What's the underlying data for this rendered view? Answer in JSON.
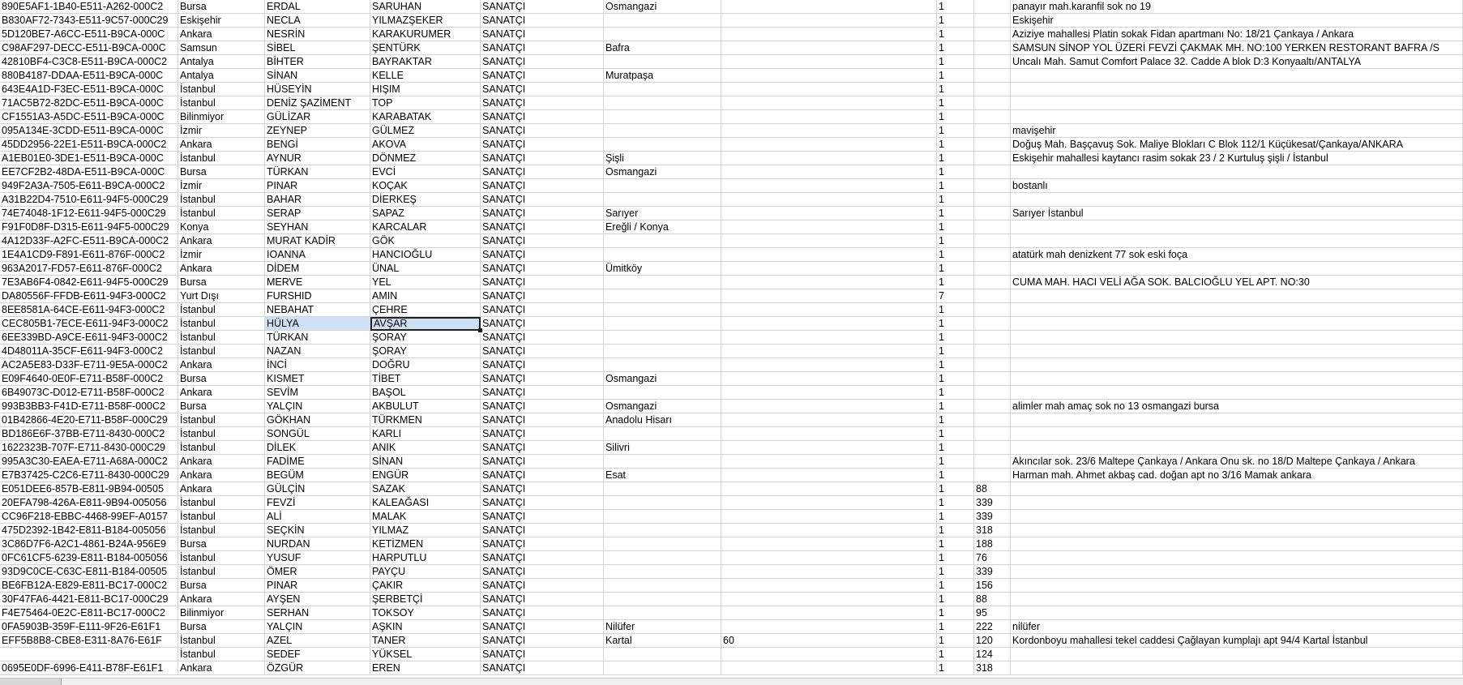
{
  "sheet": {
    "rows": [
      [
        "890E5AF1-1B40-E511-A262-000C2",
        "Bursa",
        "ERDAL",
        "SARUHAN",
        "SANATÇI",
        "Osmangazi",
        "",
        "1",
        "",
        "panayır mah.karanfil sok no 19"
      ],
      [
        "B830AF72-7343-E511-9C57-000C29",
        "Eskişehir",
        "NECLA",
        "YILMAZŞEKER",
        "SANATÇI",
        "",
        "",
        "1",
        "",
        "Eskişehir"
      ],
      [
        "5D120BE7-A6CC-E511-B9CA-000C",
        "Ankara",
        "NESRİN",
        "KARAKURUMER",
        "SANATÇI",
        "",
        "",
        "1",
        "",
        "Aziziye mahallesi Platin sokak  Fidan apartmanı No: 18/21 Çankaya / Ankara"
      ],
      [
        "C98AF297-DECC-E511-B9CA-000C",
        "Samsun",
        "SİBEL",
        "ŞENTÜRK",
        "SANATÇI",
        "Bafra",
        "",
        "1",
        "",
        "SAMSUN SİNOP YOL ÜZERİ FEVZİ ÇAKMAK MH.  NO:100 YERKEN RESTORANT  BAFRA /S"
      ],
      [
        "42810BF4-C3C8-E511-B9CA-000C2",
        "Antalya",
        "BİHTER",
        "BAYRAKTAR",
        "SANATÇI",
        "",
        "",
        "1",
        "",
        "Uncalı Mah. Samut Comfort Palace 32. Cadde A blok D:3 Konyaaltı/ANTALYA"
      ],
      [
        "880B4187-DDAA-E511-B9CA-000C",
        "Antalya",
        "SİNAN",
        "KELLE",
        "SANATÇI",
        "Muratpaşa",
        "",
        "1",
        "",
        ""
      ],
      [
        "643E4A1D-F3EC-E511-B9CA-000C",
        "İstanbul",
        "HÜSEYİN",
        "HIŞIM",
        "SANATÇI",
        "",
        "",
        "1",
        "",
        ""
      ],
      [
        "71AC5B72-82DC-E511-B9CA-000C",
        "İstanbul",
        "DENİZ ŞAZİMENT",
        "TOP",
        "SANATÇI",
        "",
        "",
        "1",
        "",
        ""
      ],
      [
        "CF1551A3-A5DC-E511-B9CA-000C",
        "Bilinmiyor",
        "GÜLİZAR",
        "KARABATAK",
        "SANATÇI",
        "",
        "",
        "1",
        "",
        ""
      ],
      [
        "095A134E-3CDD-E511-B9CA-000C",
        "İzmir",
        "ZEYNEP",
        "GÜLMEZ",
        "SANATÇI",
        "",
        "",
        "1",
        "",
        "mavişehir"
      ],
      [
        "45DD2956-22E1-E511-B9CA-000C2",
        "Ankara",
        "BENGİ",
        "AKOVA",
        "SANATÇI",
        "",
        "",
        "1",
        "",
        "Doğuş Mah. Başçavuş Sok. Maliye Blokları C Blok 112/1 Küçükesat/Çankaya/ANKARA"
      ],
      [
        "A1EB01E0-3DE1-E511-B9CA-000C",
        "İstanbul",
        "AYNUR",
        "DÖNMEZ",
        "SANATÇI",
        "Şişli",
        "",
        "1",
        "",
        "Eskişehir mahallesi kaytancı rasim sokak 23 / 2 Kurtuluş şişli / İstanbul"
      ],
      [
        "EE7CF2B2-48DA-E511-B9CA-000C",
        "Bursa",
        "TÜRKAN",
        "EVCİ",
        "SANATÇI",
        "Osmangazi",
        "",
        "1",
        "",
        ""
      ],
      [
        "949F2A3A-7505-E611-B9CA-000C2",
        "İzmir",
        "PINAR",
        "KOÇAK",
        "SANATÇI",
        "",
        "",
        "1",
        "",
        "bostanlı"
      ],
      [
        "A31B22D4-7510-E611-94F5-000C29",
        "İstanbul",
        "BAHAR",
        "DİERKEŞ",
        "SANATÇI",
        "",
        "",
        "1",
        "",
        ""
      ],
      [
        "74E74048-1F12-E611-94F5-000C29",
        "İstanbul",
        "SERAP",
        "SAPAZ",
        "SANATÇI",
        "Sarıyer",
        "",
        "1",
        "",
        "Sarıyer İstanbul"
      ],
      [
        "F91F0D8F-D315-E611-94F5-000C29",
        "Konya",
        "SEYHAN",
        "KARCALAR",
        "SANATÇI",
        "Ereğli / Konya",
        "",
        "1",
        "",
        ""
      ],
      [
        "4A12D33F-A2FC-E511-B9CA-000C2",
        "Ankara",
        "MURAT KADİR",
        "GÖK",
        "SANATÇI",
        "",
        "",
        "1",
        "",
        ""
      ],
      [
        "1E4A1CD9-F891-E611-876F-000C2",
        "İzmir",
        "IOANNA",
        "HANCIOĞLU",
        "SANATÇI",
        "",
        "",
        "1",
        "",
        "atatürk mah denizkent 77 sok eski foça"
      ],
      [
        "963A2017-FD57-E611-876F-000C2",
        "Ankara",
        "DİDEM",
        "ÜNAL",
        "SANATÇI",
        "Ümitköy",
        "",
        "1",
        "",
        ""
      ],
      [
        "7E3AB6F4-0842-E611-94F5-000C29",
        "Bursa",
        "MERVE",
        "YEL",
        "SANATÇI",
        "",
        "",
        "1",
        "",
        "CUMA MAH. HACI VELİ AĞA SOK. BALCIOĞLU YEL APT. NO:30"
      ],
      [
        "DA80556F-FFDB-E611-94F3-000C2",
        "Yurt Dışı",
        "FURSHID",
        "AMIN",
        "SANATÇI",
        "",
        "",
        "7",
        "",
        ""
      ],
      [
        "8EE8581A-64CE-E611-94F3-000C2",
        "İstanbul",
        "NEBAHAT",
        "ÇEHRE",
        "SANATÇI",
        "",
        "",
        "1",
        "",
        ""
      ],
      [
        "CEC805B1-7ECE-E611-94F3-000C2",
        "İstanbul",
        "HÜLYA",
        "AVŞAR",
        "SANATÇI",
        "",
        "",
        "1",
        "",
        ""
      ],
      [
        "6EE339BD-A9CE-E611-94F3-000C2",
        "İstanbul",
        "TÜRKAN",
        "ŞORAY",
        "SANATÇI",
        "",
        "",
        "1",
        "",
        ""
      ],
      [
        "4D48011A-35CF-E611-94F3-000C2",
        "İstanbul",
        "NAZAN",
        "ŞORAY",
        "SANATÇI",
        "",
        "",
        "1",
        "",
        ""
      ],
      [
        "AC2A5E83-D33F-E711-9E5A-000C2",
        "Ankara",
        "İNCİ",
        "DOĞRU",
        "SANATÇI",
        "",
        "",
        "1",
        "",
        ""
      ],
      [
        "E09F4640-0E0F-E711-B58F-000C2",
        "Bursa",
        "KISMET",
        "TİBET",
        "SANATÇI",
        "Osmangazi",
        "",
        "1",
        "",
        ""
      ],
      [
        "6B49073C-D012-E711-B58F-000C2",
        "Ankara",
        "SEVİM",
        "BAŞOL",
        "SANATÇI",
        "",
        "",
        "1",
        "",
        ""
      ],
      [
        "993B3BB3-F41D-E711-B58F-000C2",
        "Bursa",
        "YALÇIN",
        "AKBULUT",
        "SANATÇI",
        "Osmangazi",
        "",
        "1",
        "",
        "alimler mah amaç sok no 13 osmangazi bursa"
      ],
      [
        "01B42866-4E20-E711-B58F-000C29",
        "İstanbul",
        "GÖKHAN",
        "TÜRKMEN",
        "SANATÇI",
        "Anadolu Hisarı",
        "",
        "1",
        "",
        ""
      ],
      [
        "BD186E6F-37BB-E711-8430-000C2",
        "İstanbul",
        "SONGÜL",
        "KARLI",
        "SANATÇI",
        "",
        "",
        "1",
        "",
        ""
      ],
      [
        "1622323B-707F-E711-8430-000C29",
        "İstanbul",
        "DİLEK",
        "ANIK",
        "SANATÇI",
        "Silivri",
        "",
        "1",
        "",
        ""
      ],
      [
        "995A3C30-EAEA-E711-A68A-000C2",
        "Ankara",
        "FADİME",
        "SİNAN",
        "SANATÇI",
        "",
        "",
        "1",
        "",
        "Akıncılar sok. 23/6 Maltepe Çankaya / Ankara Onu sk. no 18/D  Maltepe  Çankaya  / Ankara"
      ],
      [
        "E7B37425-C2C6-E711-8430-000C29",
        "Ankara",
        "BEGÜM",
        "ENGÜR",
        "SANATÇI",
        "Esat",
        "",
        "1",
        "",
        "Harman mah. Ahmet akbaş cad. doğan apt no 3/16 Mamak ankara"
      ],
      [
        "E051DEE6-857B-E811-9B94-00505",
        "Ankara",
        "GÜLÇİN",
        "SAZAK",
        "SANATÇI",
        "",
        "",
        "1",
        "88",
        ""
      ],
      [
        "20EFA798-426A-E811-9B94-005056",
        "İstanbul",
        "FEVZİ",
        "KALEAĞASI",
        "SANATÇI",
        "",
        "",
        "1",
        "339",
        ""
      ],
      [
        "CC96F218-EBBC-4468-99EF-A0157",
        "İstanbul",
        "ALİ",
        "MALAK",
        "SANATÇI",
        "",
        "",
        "1",
        "339",
        ""
      ],
      [
        "475D2392-1B42-E811-B184-005056",
        "İstanbul",
        "SEÇKİN",
        "YILMAZ",
        "SANATÇI",
        "",
        "",
        "1",
        "318",
        ""
      ],
      [
        "3C86D7F6-A2C1-4861-B24A-956E9",
        "Bursa",
        "NURDAN",
        "KETİZMEN",
        "SANATÇI",
        "",
        "",
        "1",
        "188",
        ""
      ],
      [
        "0FC61CF5-6239-E811-B184-005056",
        "İstanbul",
        "YUSUF",
        "HARPUTLU",
        "SANATÇI",
        "",
        "",
        "1",
        "76",
        ""
      ],
      [
        "93D9C0CE-C63C-E811-B184-00505",
        "İstanbul",
        "ÖMER",
        "PAYÇU",
        "SANATÇI",
        "",
        "",
        "1",
        "339",
        ""
      ],
      [
        "BE6FB12A-E829-E811-BC17-000C2",
        "Bursa",
        "PINAR",
        "ÇAKIR",
        "SANATÇI",
        "",
        "",
        "1",
        "156",
        ""
      ],
      [
        "30F47FA6-4421-E811-BC17-000C29",
        "Ankara",
        "AYŞEN",
        "ŞERBETÇİ",
        "SANATÇI",
        "",
        "",
        "1",
        "88",
        ""
      ],
      [
        "F4E75464-0E2C-E811-BC17-000C2",
        "Bilinmiyor",
        "SERHAN",
        "TOKSOY",
        "SANATÇI",
        "",
        "",
        "1",
        "95",
        ""
      ],
      [
        "0FA5903B-359F-E111-9F26-E61F1",
        "Bursa",
        "YALÇIN",
        "AŞKIN",
        "SANATÇI",
        "Nilüfer",
        "",
        "1",
        "222",
        "nilüfer"
      ],
      [
        "EFF5B8B8-CBE8-E311-8A76-E61F",
        "İstanbul",
        "AZEL",
        "TANER",
        "SANATÇI",
        "Kartal",
        "60",
        "1",
        "120",
        "Kordonboyu mahallesi tekel caddesi Çağlayan kumplajı apt 94/4 Kartal İstanbul"
      ],
      [
        "",
        "İstanbul",
        "SEDEF",
        "YÜKSEL",
        "SANATÇI",
        "",
        "",
        "1",
        "124",
        ""
      ],
      [
        "0695E0DF-6996-E411-B78F-E61F1",
        "Ankara",
        "ÖZGÜR",
        "EREN",
        "SANATÇI",
        "",
        "",
        "1",
        "318",
        ""
      ]
    ]
  }
}
